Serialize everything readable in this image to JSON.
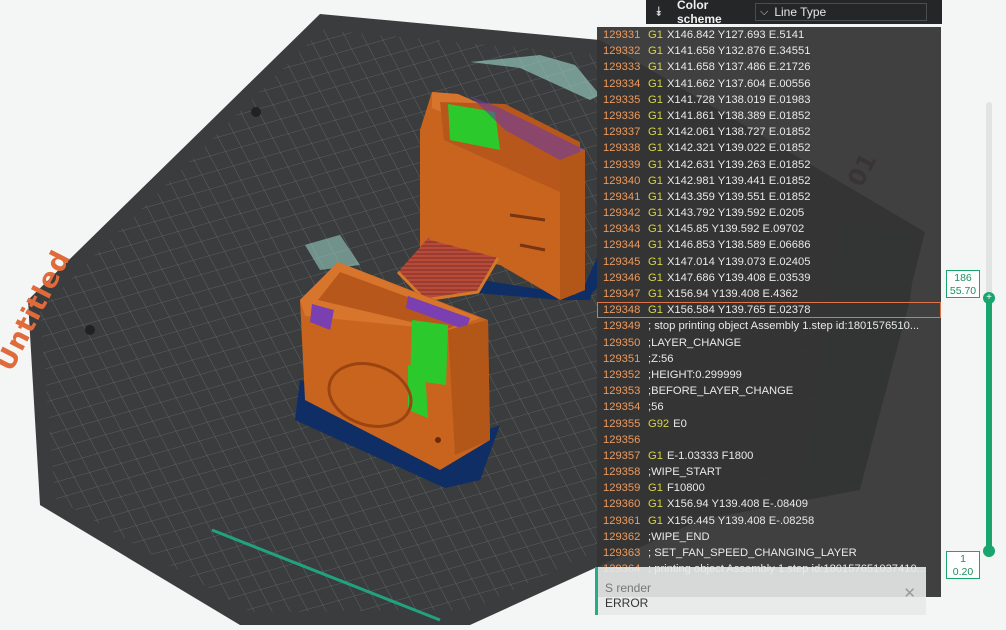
{
  "plate": {
    "name": "Untitled",
    "number": "01"
  },
  "color_scheme": {
    "label": "Color scheme",
    "value": "Line Type"
  },
  "gcode": {
    "lines": [
      {
        "n": "129331",
        "cmd": "G1",
        "text": "X146.842 Y127.693 E.5141"
      },
      {
        "n": "129332",
        "cmd": "G1",
        "text": "X141.658 Y132.876 E.34551"
      },
      {
        "n": "129333",
        "cmd": "G1",
        "text": "X141.658 Y137.486 E.21726"
      },
      {
        "n": "129334",
        "cmd": "G1",
        "text": "X141.662 Y137.604 E.00556"
      },
      {
        "n": "129335",
        "cmd": "G1",
        "text": "X141.728 Y138.019 E.01983"
      },
      {
        "n": "129336",
        "cmd": "G1",
        "text": "X141.861 Y138.389 E.01852"
      },
      {
        "n": "129337",
        "cmd": "G1",
        "text": "X142.061 Y138.727 E.01852"
      },
      {
        "n": "129338",
        "cmd": "G1",
        "text": "X142.321 Y139.022 E.01852"
      },
      {
        "n": "129339",
        "cmd": "G1",
        "text": "X142.631 Y139.263 E.01852"
      },
      {
        "n": "129340",
        "cmd": "G1",
        "text": "X142.981 Y139.441 E.01852"
      },
      {
        "n": "129341",
        "cmd": "G1",
        "text": "X143.359 Y139.551 E.01852"
      },
      {
        "n": "129342",
        "cmd": "G1",
        "text": "X143.792 Y139.592 E.0205"
      },
      {
        "n": "129343",
        "cmd": "G1",
        "text": "X145.85 Y139.592 E.09702"
      },
      {
        "n": "129344",
        "cmd": "G1",
        "text": "X146.853 Y138.589 E.06686"
      },
      {
        "n": "129345",
        "cmd": "G1",
        "text": "X147.014 Y139.073 E.02405"
      },
      {
        "n": "129346",
        "cmd": "G1",
        "text": "X147.686 Y139.408 E.03539"
      },
      {
        "n": "129347",
        "cmd": "G1",
        "text": "X156.94 Y139.408 E.4362"
      },
      {
        "n": "129348",
        "cmd": "G1",
        "text": "X156.584 Y139.765 E.02378"
      },
      {
        "n": "129349",
        "cmd": "",
        "text": "; stop printing object Assembly 1.step id:1801576510..."
      },
      {
        "n": "129350",
        "cmd": "",
        "text": ";LAYER_CHANGE"
      },
      {
        "n": "129351",
        "cmd": "",
        "text": ";Z:56"
      },
      {
        "n": "129352",
        "cmd": "",
        "text": ";HEIGHT:0.299999"
      },
      {
        "n": "129353",
        "cmd": "",
        "text": ";BEFORE_LAYER_CHANGE"
      },
      {
        "n": "129354",
        "cmd": "",
        "text": ";56"
      },
      {
        "n": "129355",
        "cmd": "G92",
        "text": "E0"
      },
      {
        "n": "129356",
        "cmd": "",
        "text": ""
      },
      {
        "n": "129357",
        "cmd": "G1",
        "text": "E-1.03333 F1800"
      },
      {
        "n": "129358",
        "cmd": "",
        "text": ";WIPE_START"
      },
      {
        "n": "129359",
        "cmd": "G1",
        "text": "F10800"
      },
      {
        "n": "129360",
        "cmd": "G1",
        "text": "X156.94 Y139.408 E-.08409"
      },
      {
        "n": "129361",
        "cmd": "G1",
        "text": "X156.445 Y139.408 E-.08258"
      },
      {
        "n": "129362",
        "cmd": "",
        "text": ";WIPE_END"
      },
      {
        "n": "129363",
        "cmd": "",
        "text": "; SET_FAN_SPEED_CHANGING_LAYER"
      },
      {
        "n": "129364",
        "cmd": "",
        "text": "; printing object Assembly 1.step id:180157651037410..."
      }
    ]
  },
  "messages": {
    "line1": "S render",
    "line2": "ERROR"
  },
  "layer_slider": {
    "top_layer": "186",
    "top_height": "55.70",
    "bottom_layer": "1",
    "bottom_height": "0.20",
    "position_fraction": 0.44
  },
  "colors": {
    "accent": "#19a56e",
    "part_orange": "#c8641e",
    "support_green": "#28c828",
    "brim_blue": "#12356a",
    "bed_dark": "#3a3c3d"
  }
}
